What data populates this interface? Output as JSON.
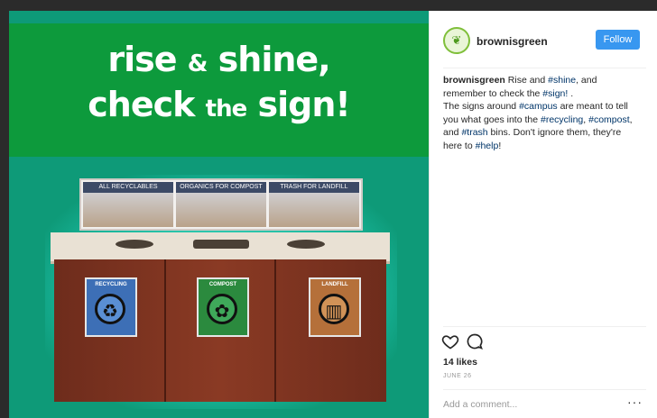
{
  "image": {
    "headline_line1_a": "rise",
    "headline_line1_amp": "&",
    "headline_line1_b": "shine,",
    "headline_line2_a": "check",
    "headline_line2_the": "the",
    "headline_line2_b": "sign!",
    "signboard": [
      "ALL RECYCLABLES",
      "ORGANICS FOR COMPOST",
      "TRASH FOR LANDFILL"
    ],
    "bins": [
      {
        "label": "RECYCLING",
        "icon": "recycle-icon",
        "color": "#3d6fb6",
        "glyph": "♻"
      },
      {
        "label": "COMPOST",
        "icon": "sprout-icon",
        "color": "#2b8a3e",
        "glyph": "✿"
      },
      {
        "label": "LANDFILL",
        "icon": "trash-icon",
        "color": "#b5703a",
        "glyph": "▥"
      }
    ],
    "banner_color": "#0d9a3c",
    "background_color": "#0e9a78"
  },
  "header": {
    "avatar_icon": "leaf-icon",
    "username": "brownisgreen",
    "follow_label": "Follow",
    "follow_color": "#3897f0"
  },
  "caption": {
    "username": "brownisgreen",
    "t1": " Rise and ",
    "h1": "#shine",
    "t2": ", and remember to check the ",
    "h2": "#sign!",
    "t3": " .",
    "t4": "The signs around ",
    "h3": "#campus",
    "t5": " are meant to tell you what goes into the ",
    "h4": "#recycling",
    "t6": ", ",
    "h5": "#compost",
    "t7": ", and ",
    "h6": "#trash",
    "t8": " bins. Don't ignore them, they're here to ",
    "h7": "#help",
    "t9": "!"
  },
  "actions": {
    "like_icon": "heart-icon",
    "comment_icon": "comment-icon"
  },
  "likes": "14 likes",
  "date": "JUNE 26",
  "comment_placeholder": "Add a comment...",
  "more_label": "···"
}
